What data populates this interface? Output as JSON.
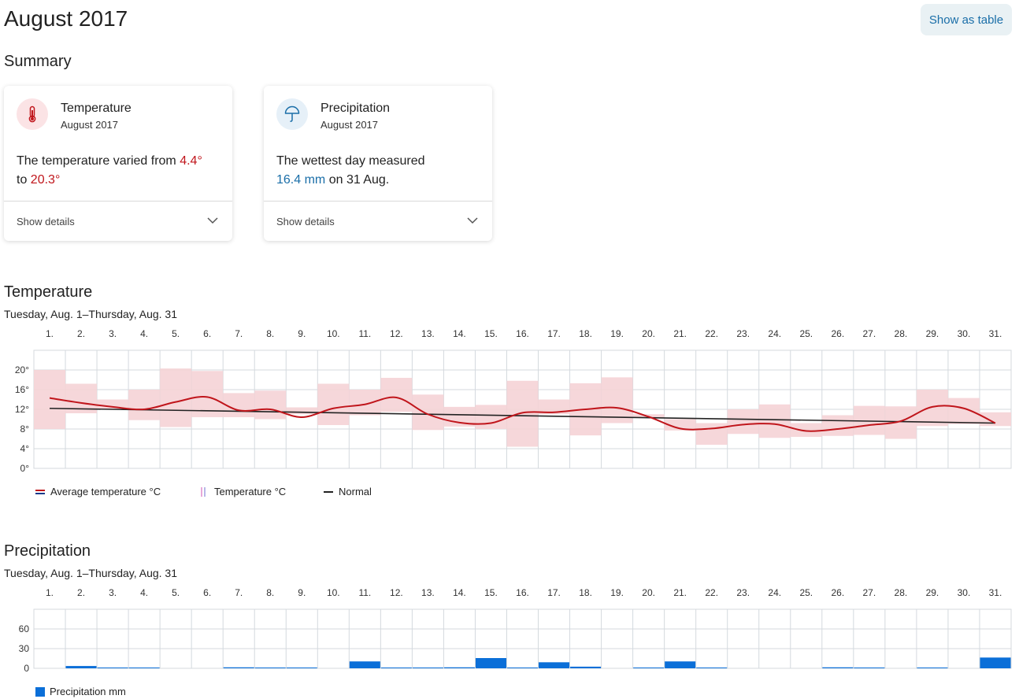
{
  "header": {
    "title": "August 2017",
    "show_table_label": "Show as table"
  },
  "summary": {
    "title": "Summary",
    "temperature_card": {
      "icon": "thermometer-icon",
      "title": "Temperature",
      "subtitle": "August 2017",
      "text_prefix": "The temperature varied from ",
      "min": "4.4°",
      "text_middle": " to ",
      "max": "20.3°",
      "details_label": "Show details",
      "accent_color": "#c0151b"
    },
    "precipitation_card": {
      "icon": "umbrella-icon",
      "title": "Precipitation",
      "subtitle": "August 2017",
      "text_prefix": "The wettest day measured ",
      "amount": "16.4 mm",
      "text_suffix": " on 31 Aug.",
      "details_label": "Show details",
      "accent_color": "#1a6ea8"
    }
  },
  "temperature_section": {
    "title": "Temperature",
    "range": "Tuesday, Aug. 1–Thursday, Aug. 31"
  },
  "precipitation_section": {
    "title": "Precipitation",
    "range": "Tuesday, Aug. 1–Thursday, Aug. 31"
  },
  "chart_data": [
    {
      "type": "line",
      "categories": [
        "1.",
        "2.",
        "3.",
        "4.",
        "5.",
        "6.",
        "7.",
        "8.",
        "9.",
        "10.",
        "11.",
        "12.",
        "13.",
        "14.",
        "15.",
        "16.",
        "17.",
        "18.",
        "19.",
        "20.",
        "21.",
        "22.",
        "23.",
        "24.",
        "25.",
        "26.",
        "27.",
        "28.",
        "29.",
        "30.",
        "31."
      ],
      "y_ticks": [
        "0°",
        "4°",
        "8°",
        "12°",
        "16°",
        "20°"
      ],
      "ylim": [
        0,
        24
      ],
      "grid": true,
      "legend_position": "bottom-left",
      "series": [
        {
          "name": "Average temperature °C",
          "kind": "line",
          "color": "#c0151b",
          "values": [
            14.3,
            13.3,
            12.5,
            12.0,
            13.5,
            14.5,
            11.8,
            12.0,
            10.4,
            12.2,
            13.0,
            14.4,
            11.0,
            9.3,
            9.2,
            11.3,
            11.4,
            12.0,
            12.3,
            10.5,
            8.1,
            8.1,
            8.9,
            9.0,
            7.6,
            8.0,
            8.8,
            9.6,
            12.5,
            12.2,
            9.2
          ]
        },
        {
          "name": "Temperature °C",
          "kind": "range",
          "color": "#f5d3d6",
          "min": [
            8.0,
            11.2,
            12.0,
            9.8,
            8.4,
            10.4,
            10.4,
            10.0,
            11.0,
            8.8,
            10.8,
            11.5,
            7.8,
            8.5,
            8.0,
            4.4,
            11.0,
            6.7,
            9.2,
            10.3,
            7.7,
            4.8,
            7.0,
            6.2,
            6.4,
            6.6,
            6.8,
            6.0,
            8.6,
            9.0,
            8.6
          ],
          "max": [
            20.0,
            17.2,
            14.0,
            16.0,
            20.3,
            19.8,
            15.3,
            15.8,
            12.4,
            17.2,
            16.0,
            18.4,
            15.0,
            12.5,
            12.9,
            17.8,
            14.0,
            17.3,
            18.5,
            11.0,
            10.0,
            9.2,
            12.0,
            13.0,
            9.2,
            10.8,
            12.7,
            12.6,
            16.0,
            14.3,
            11.4
          ]
        },
        {
          "name": "Normal",
          "kind": "line",
          "color": "#222222",
          "start": 12.2,
          "end": 9.2
        }
      ]
    },
    {
      "type": "bar",
      "categories": [
        "1.",
        "2.",
        "3.",
        "4.",
        "5.",
        "6.",
        "7.",
        "8.",
        "9.",
        "10.",
        "11.",
        "12.",
        "13.",
        "14.",
        "15.",
        "16.",
        "17.",
        "18.",
        "19.",
        "20.",
        "21.",
        "22.",
        "23.",
        "24.",
        "25.",
        "26.",
        "27.",
        "28.",
        "29.",
        "30.",
        "31."
      ],
      "y_ticks": [
        "0",
        "30",
        "60"
      ],
      "ylim": [
        0,
        90
      ],
      "grid": true,
      "legend_position": "bottom-left",
      "series": [
        {
          "name": "Precipitation mm",
          "color": "#0b6fd8",
          "values": [
            0,
            3.5,
            1.2,
            0.6,
            0,
            0,
            1.5,
            0.3,
            0.3,
            0,
            10.5,
            0.4,
            1.0,
            1.5,
            15.6,
            1.2,
            9.2,
            2.5,
            0,
            0.3,
            10.5,
            0.4,
            0,
            0,
            0,
            1.5,
            0.3,
            0,
            0.6,
            0,
            16.4
          ]
        }
      ]
    }
  ]
}
